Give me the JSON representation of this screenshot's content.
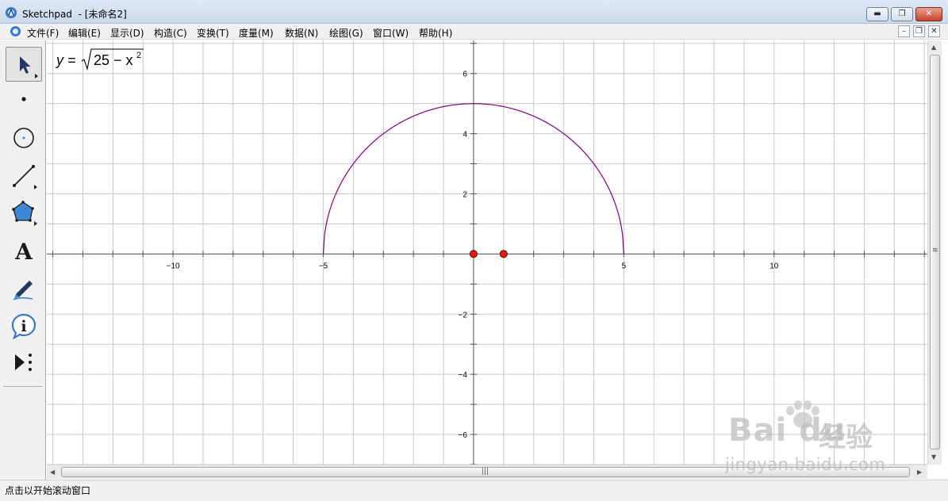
{
  "window": {
    "title": "Sketchpad  - [未命名2]",
    "minimize_glyph": "▬",
    "restore_glyph": "❐",
    "close_glyph": "✕"
  },
  "menu": {
    "items": [
      "文件(F)",
      "编辑(E)",
      "显示(D)",
      "构造(C)",
      "变换(T)",
      "度量(M)",
      "数据(N)",
      "绘图(G)",
      "窗口(W)",
      "帮助(H)"
    ],
    "mdi_minimize": "–",
    "mdi_restore": "❐",
    "mdi_close": "✕"
  },
  "tools": [
    "arrow-select-tool",
    "point-tool",
    "compass-tool",
    "straightedge-tool",
    "polygon-tool",
    "text-tool",
    "marker-tool",
    "information-tool",
    "custom-tool"
  ],
  "tool_text": "A",
  "tool_info": "i",
  "equation": {
    "lhs": "y =",
    "radicand": "25 − x",
    "exponent": "2"
  },
  "scroll": {
    "grip": "|||",
    "vgrip": "≡",
    "up": "▲",
    "down": "▼",
    "left": "◀",
    "right": "▶"
  },
  "statusbar": {
    "text": "点击以开始滚动窗口"
  },
  "watermark": {
    "brand": "Bai du",
    "brand_cn": "经验",
    "url": "jingyan.baidu.com"
  },
  "colors": {
    "curve": "#800080",
    "point_fill": "#e51b1b",
    "grid": "#c8c8c8",
    "axis": "#555555"
  },
  "chart_data": {
    "type": "line",
    "function": "y = sqrt(25 - x^2)",
    "x_domain": [
      -5,
      5
    ],
    "xlim": [
      -14.2,
      15.1
    ],
    "ylim": [
      -7.0,
      7.1
    ],
    "grid": true,
    "x_ticks": [
      -10,
      -5,
      5,
      10
    ],
    "x_tick_labels": [
      "−10",
      "−5",
      "5",
      "10"
    ],
    "y_ticks": [
      6,
      4,
      2,
      -2,
      -4,
      -6
    ],
    "y_tick_labels": [
      "6",
      "4",
      "2",
      "−2",
      "−4",
      "−6"
    ],
    "points": [
      {
        "x": 0,
        "y": 0
      },
      {
        "x": 1,
        "y": 0
      }
    ]
  }
}
